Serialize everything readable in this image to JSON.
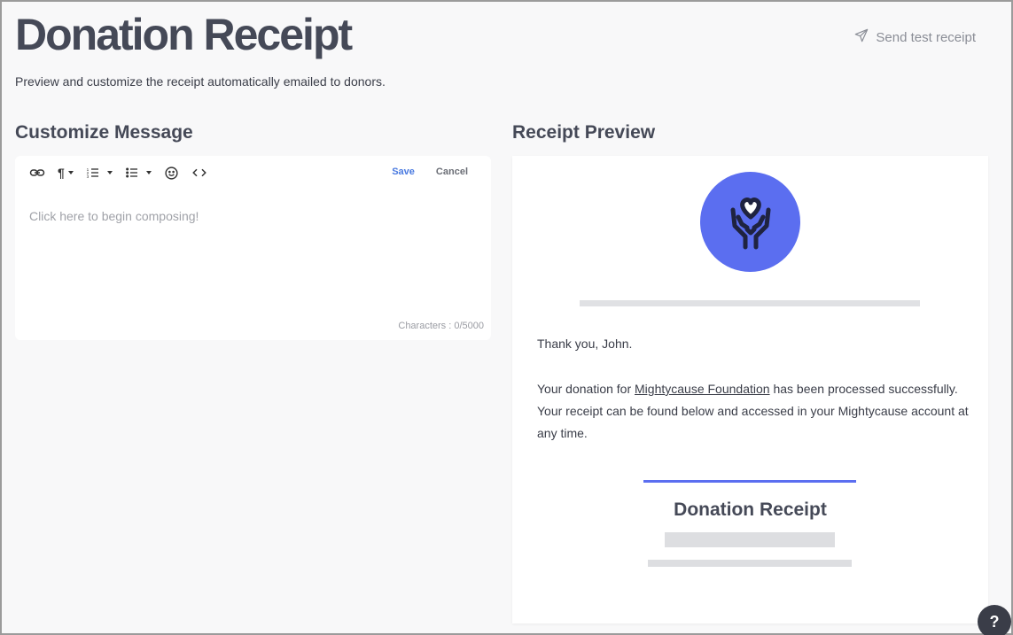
{
  "header": {
    "title": "Donation Receipt",
    "subtitle": "Preview and customize the receipt automatically emailed to donors.",
    "send_test_label": "Send test receipt"
  },
  "editor": {
    "section_title": "Customize Message",
    "toolbar_icons": [
      "link-icon",
      "paragraph-icon",
      "ordered-list-icon",
      "unordered-list-icon",
      "emoji-icon",
      "code-icon"
    ],
    "save_label": "Save",
    "cancel_label": "Cancel",
    "placeholder": "Click here to begin composing!",
    "char_count": "Characters : 0/5000"
  },
  "preview": {
    "section_title": "Receipt Preview",
    "greeting": "Thank you, John.",
    "body_prefix": "Your donation for ",
    "org_link": "Mightycause Foundation",
    "body_suffix": " has been processed successfully. Your receipt can be found below and accessed in your Mightycause account at any time.",
    "receipt_title": "Donation Receipt",
    "accent_color": "#5b6ef0"
  },
  "help": {
    "label": "?"
  }
}
